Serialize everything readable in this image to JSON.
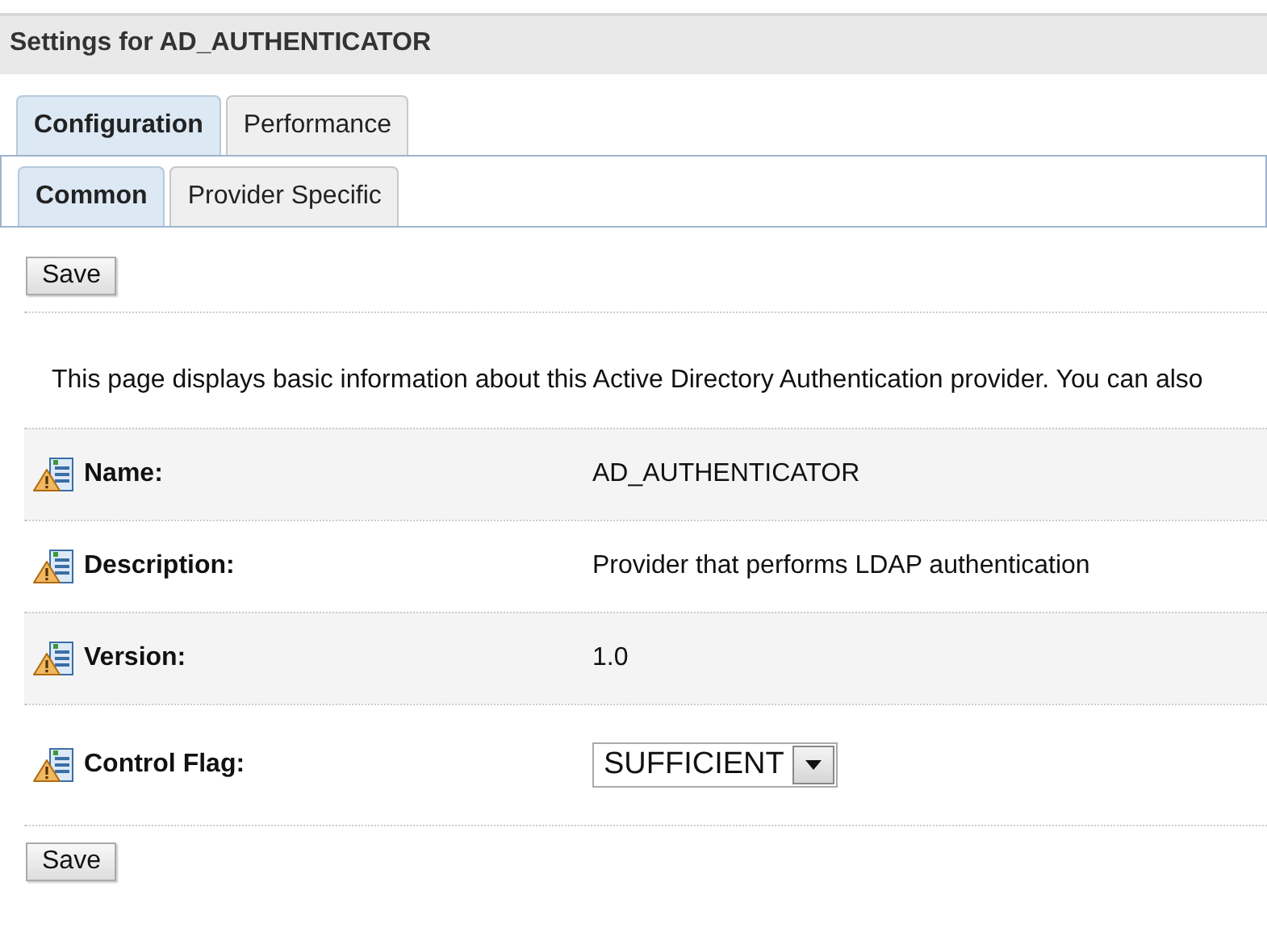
{
  "title": "Settings for AD_AUTHENTICATOR",
  "tabs": [
    {
      "label": "Configuration",
      "selected": true
    },
    {
      "label": "Performance",
      "selected": false
    }
  ],
  "subtabs": [
    {
      "label": "Common",
      "selected": true
    },
    {
      "label": "Provider Specific",
      "selected": false
    }
  ],
  "save_top": "Save",
  "intro": "This page displays basic information about this Active Directory Authentication provider. You can also",
  "fields": [
    {
      "kind": "text",
      "label": "Name:",
      "value": "AD_AUTHENTICATOR"
    },
    {
      "kind": "text",
      "label": "Description:",
      "value": "Provider that performs LDAP authentication"
    },
    {
      "kind": "text",
      "label": "Version:",
      "value": "1.0"
    },
    {
      "kind": "select",
      "label": "Control Flag:",
      "value": "SUFFICIENT"
    }
  ],
  "save_bottom": "Save"
}
